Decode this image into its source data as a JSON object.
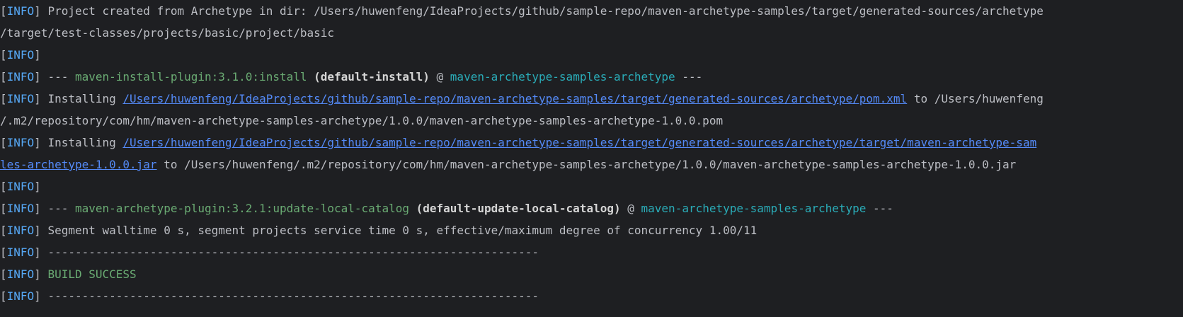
{
  "console": {
    "level": "INFO",
    "lines": [
      {
        "type": "text",
        "text": "Project created from Archetype in dir: /Users/huwenfeng/IdeaProjects/github/sample-repo/maven-archetype-samples/target/generated-sources/archetype"
      },
      {
        "type": "cont",
        "text": "/target/test-classes/projects/basic/project/basic"
      },
      {
        "type": "empty"
      },
      {
        "type": "plugin",
        "prefix": "--- ",
        "plugin": "maven-install-plugin:3.1.0:install",
        "execution": "(default-install)",
        "at": " @ ",
        "artifact": "maven-archetype-samples-archetype",
        "suffix": " ---"
      },
      {
        "type": "install",
        "prefix": "Installing ",
        "link": "/Users/huwenfeng/IdeaProjects/github/sample-repo/maven-archetype-samples/target/generated-sources/archetype/pom.xml",
        "rest": " to /Users/huwenfeng"
      },
      {
        "type": "cont",
        "text": "/.m2/repository/com/hm/maven-archetype-samples-archetype/1.0.0/maven-archetype-samples-archetype-1.0.0.pom"
      },
      {
        "type": "install",
        "prefix": "Installing ",
        "link": "/Users/huwenfeng/IdeaProjects/github/sample-repo/maven-archetype-samples/target/generated-sources/archetype/target/maven-archetype-sam",
        "rest": ""
      },
      {
        "type": "contlink",
        "link": "les-archetype-1.0.0.jar",
        "rest": " to /Users/huwenfeng/.m2/repository/com/hm/maven-archetype-samples-archetype/1.0.0/maven-archetype-samples-archetype-1.0.0.jar"
      },
      {
        "type": "empty"
      },
      {
        "type": "plugin",
        "prefix": "--- ",
        "plugin": "maven-archetype-plugin:3.2.1:update-local-catalog",
        "execution": "(default-update-local-catalog)",
        "at": " @ ",
        "artifact": "maven-archetype-samples-archetype",
        "suffix": " ---"
      },
      {
        "type": "text",
        "text": "Segment walltime 0 s, segment projects service time 0 s, effective/maximum degree of concurrency 1.00/11"
      },
      {
        "type": "text",
        "text": "------------------------------------------------------------------------"
      },
      {
        "type": "success",
        "text": "BUILD SUCCESS"
      },
      {
        "type": "text",
        "text": "------------------------------------------------------------------------"
      }
    ]
  }
}
